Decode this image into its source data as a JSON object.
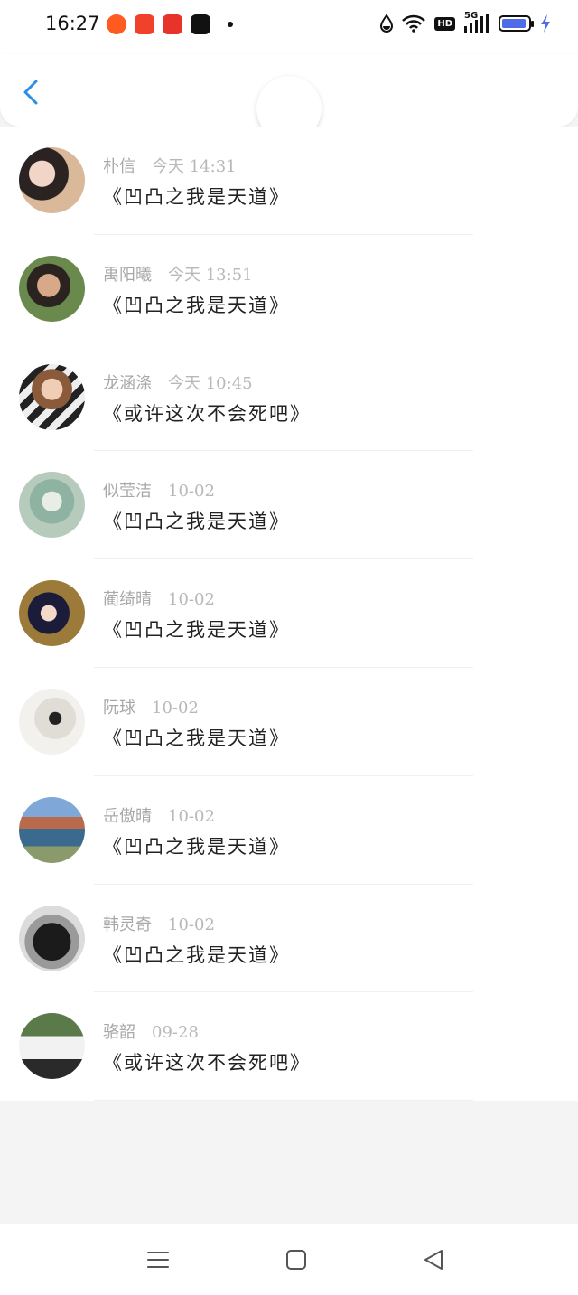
{
  "status_bar": {
    "time": "16:27",
    "network": "5G",
    "hd": "HD"
  },
  "header": {
    "back_icon": "chevron-left-icon"
  },
  "messages": [
    {
      "name": "朴信",
      "time": "今天 14:31",
      "text": "《凹凸之我是天道》"
    },
    {
      "name": "禹阳曦",
      "time": "今天 13:51",
      "text": "《凹凸之我是天道》"
    },
    {
      "name": "龙涵涤",
      "time": "今天 10:45",
      "text": "《或许这次不会死吧》"
    },
    {
      "name": "似莹洁",
      "time": "10-02",
      "text": "《凹凸之我是天道》"
    },
    {
      "name": "蔺绮晴",
      "time": "10-02",
      "text": "《凹凸之我是天道》"
    },
    {
      "name": "阮球",
      "time": "10-02",
      "text": "《凹凸之我是天道》"
    },
    {
      "name": "岳傲晴",
      "time": "10-02",
      "text": "《凹凸之我是天道》"
    },
    {
      "name": "韩灵奇",
      "time": "10-02",
      "text": "《凹凸之我是天道》"
    },
    {
      "name": "骆韶",
      "time": "09-28",
      "text": "《或许这次不会死吧》"
    }
  ],
  "nav": {
    "menu_icon": "menu-icon",
    "home_icon": "home-square-icon",
    "back_icon": "back-triangle-icon"
  },
  "colors": {
    "accent": "#2b8fe6",
    "background": "#f5f4f4"
  }
}
